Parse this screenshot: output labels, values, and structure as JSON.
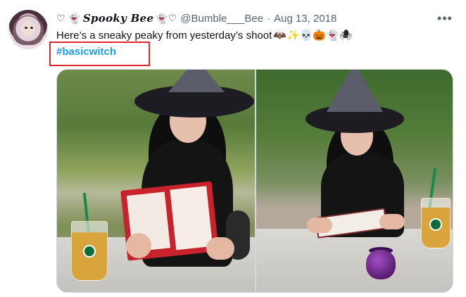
{
  "tweet": {
    "author": {
      "display_name": "Spooky Bee",
      "prefix_glyphs": "♡ 👻",
      "suffix_glyphs": "👻♡",
      "handle": "@Bumble___Bee",
      "separator": "·",
      "date": "Aug 13, 2018",
      "avatar_icon": "witch-avatar-icon"
    },
    "text": "Here’s a sneaky peaky from yesterday’s shoot",
    "emojis": "🦇✨💀🎃👻🕷",
    "hashtag": "#basicwitch",
    "more_label": "•••",
    "highlight_color": "#e0292f",
    "link_color": "#1d9bf0",
    "media": {
      "count": 2,
      "items": [
        {
          "subject": "witch-reading-book-photo-left"
        },
        {
          "subject": "witch-reading-book-photo-right"
        }
      ]
    }
  }
}
